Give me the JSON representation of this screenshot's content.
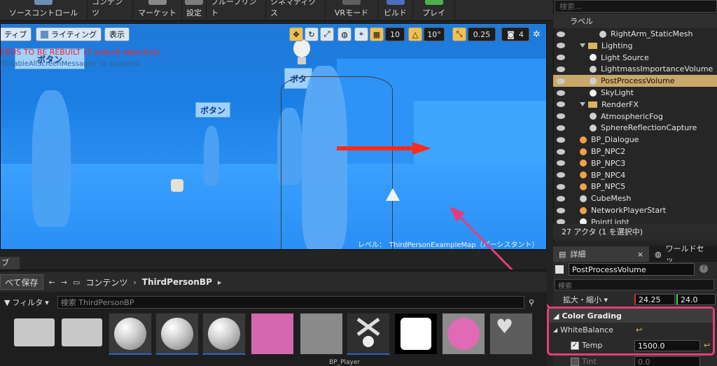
{
  "toolbar": {
    "items": [
      {
        "label": "ソースコントロール",
        "icon": "source-control-icon",
        "color": "#6b8fb5"
      },
      {
        "label": "コンテンツ",
        "icon": "content-icon",
        "color": "#b59a5e"
      },
      {
        "label": "マーケット",
        "icon": "marketplace-icon",
        "color": "#8a8a8a"
      },
      {
        "label": "設定",
        "icon": "settings-icon",
        "color": "#7e7e7e"
      },
      {
        "label": "ブループリント",
        "icon": "blueprint-icon",
        "color": "#4a7ac2"
      },
      {
        "label": "シネマティクス",
        "icon": "cinematics-icon",
        "color": "#c29a4a"
      },
      {
        "label": "VRモード",
        "icon": "vr-mode-icon",
        "color": "#5f5f5f"
      },
      {
        "label": "ビルド",
        "icon": "build-icon",
        "color": "#4a6fbf"
      },
      {
        "label": "プレイ",
        "icon": "play-icon",
        "color": "#4caf50"
      }
    ]
  },
  "viewport": {
    "view_mode_label": "ティブ",
    "lighting_label": "ライティング",
    "show_label": "表示",
    "grid_snap": "10",
    "rotation_snap": "10°",
    "scale_snap": "0.25",
    "camera_speed": "4",
    "error_text": "EEDS TO BE REBUILT (7 unbuilt object(s))",
    "hint_text": "'DisableAllScreenMessages' to suppress",
    "sign_labels": [
      "ボタン",
      "ボタン",
      "ボタ"
    ],
    "level_text": "レベル：　ThirdPersonExampleMap（パーシスタント）"
  },
  "content_browser": {
    "tab_label": "ブ",
    "save_all_label": "べて保存",
    "breadcrumb": [
      "コンテンツ",
      "ThirdPersonBP"
    ],
    "filter_label": "フィルタ",
    "search_placeholder": "検索 ThirdPersonBP",
    "visible_asset_label": "BP_Player"
  },
  "outliner": {
    "search_placeholder": "検索...",
    "header_label": "ラベル",
    "rows": [
      {
        "label": "RightArm_StaticMesh",
        "indent": 3,
        "type": "mesh"
      },
      {
        "label": "Lighting",
        "indent": 1,
        "type": "folder"
      },
      {
        "label": "Light Source",
        "indent": 2,
        "type": "light"
      },
      {
        "label": "LightmassImportanceVolume",
        "indent": 2,
        "type": "volume"
      },
      {
        "label": "PostProcessVolume",
        "indent": 2,
        "type": "volume",
        "selected": true
      },
      {
        "label": "SkyLight",
        "indent": 2,
        "type": "skylight"
      },
      {
        "label": "RenderFX",
        "indent": 1,
        "type": "folder"
      },
      {
        "label": "AtmosphericFog",
        "indent": 2,
        "type": "fog"
      },
      {
        "label": "SphereReflectionCapture",
        "indent": 2,
        "type": "reflection"
      },
      {
        "label": "BP_Dialogue",
        "indent": 1,
        "type": "actor"
      },
      {
        "label": "BP_NPC2",
        "indent": 1,
        "type": "actor"
      },
      {
        "label": "BP_NPC3",
        "indent": 1,
        "type": "actor"
      },
      {
        "label": "BP_NPC4",
        "indent": 1,
        "type": "actor"
      },
      {
        "label": "BP_NPC5",
        "indent": 1,
        "type": "actor"
      },
      {
        "label": "CubeMesh",
        "indent": 1,
        "type": "mesh"
      },
      {
        "label": "NetworkPlayerStart",
        "indent": 1,
        "type": "actor"
      },
      {
        "label": "PointLight",
        "indent": 1,
        "type": "light"
      }
    ],
    "actor_count": "27 アクタ (1 を選択中)"
  },
  "details": {
    "tab_label": "詳細",
    "other_tab_label": "ワールドセッ",
    "object_name": "PostProcessVolume",
    "search_placeholder": "検索",
    "scale_label": "拡大・縮小",
    "scale_x": "24.25",
    "scale_y": "24.0",
    "section_title": "Color Grading",
    "subsection_title": "WhiteBalance",
    "temp_label": "Temp",
    "temp_value": "1500.0",
    "tint_label": "Tint",
    "tint_value": "0.0"
  },
  "colors": {
    "highlight": "#e63d7a",
    "selection": "#caa86a"
  }
}
